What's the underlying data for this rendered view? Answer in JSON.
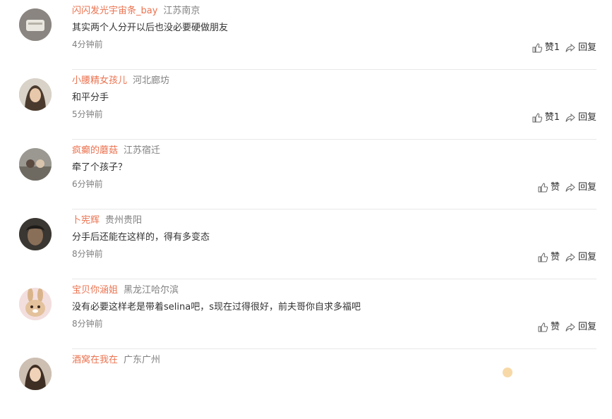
{
  "comments": [
    {
      "username": "闪闪发光宇宙条_bay",
      "location": "江苏南京",
      "text": "其实两个人分开以后也没必要硬做朋友",
      "time": "4分钟前",
      "like_label": "赞1",
      "reply_label": "回复",
      "avatar": "avatar-icon"
    },
    {
      "username": "小腰精女孩儿",
      "location": "河北廊坊",
      "text": "和平分手",
      "time": "5分钟前",
      "like_label": "赞1",
      "reply_label": "回复",
      "avatar": "avatar-icon"
    },
    {
      "username": "疯癫的蘑菇",
      "location": "江苏宿迁",
      "text": "牵了个孩子？",
      "time": "6分钟前",
      "like_label": "赞",
      "reply_label": "回复",
      "avatar": "avatar-icon"
    },
    {
      "username": "卜宪辉",
      "location": "贵州贵阳",
      "text": "分手后还能在这样的，得有多变态",
      "time": "8分钟前",
      "like_label": "赞",
      "reply_label": "回复",
      "avatar": "avatar-icon"
    },
    {
      "username": "宝贝你涵姐",
      "location": "黑龙江哈尔滨",
      "text": "没有必要这样老是带着selina吧，s现在过得很好，前夫哥你自求多福吧",
      "time": "8分钟前",
      "like_label": "赞",
      "reply_label": "回复",
      "avatar": "bunny-avatar-icon"
    },
    {
      "username": "酒窝在我在",
      "location": "广东广州",
      "text": "",
      "time": "",
      "like_label": "",
      "reply_label": "",
      "avatar": "avatar-icon"
    }
  ],
  "colors": {
    "username": "#eb7350",
    "meta": "#808080",
    "text": "#333333",
    "divider": "#e8e8e8"
  }
}
